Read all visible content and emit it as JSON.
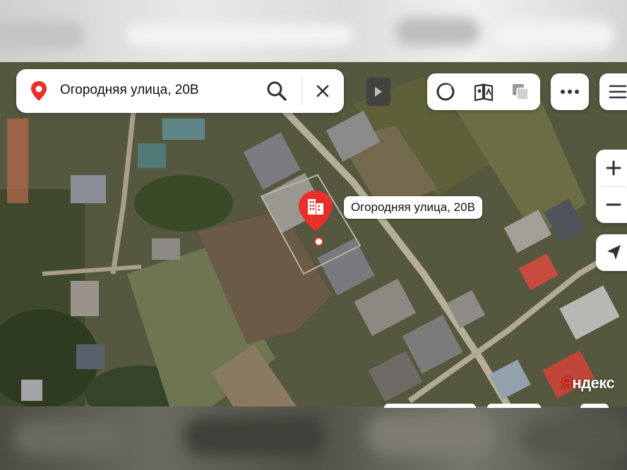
{
  "search": {
    "query": "Огородняя улица, 20В",
    "icons": {
      "pin": "location-pin-icon",
      "search": "search-icon",
      "close": "close-icon"
    }
  },
  "toolbar": {
    "icons": [
      "alice-assistant-icon",
      "panorama-book-icon",
      "layers-icon"
    ],
    "more_icon": "more-dots-icon",
    "menu_icon": "hamburger-menu-icon"
  },
  "zoom": {
    "in_label": "+",
    "out_label": "−"
  },
  "locate_icon": "navigate-arrow-icon",
  "marker": {
    "label": "Огородняя улица, 20В",
    "icon": "building-icon",
    "color": "#e8302b"
  },
  "brand": {
    "first_letter": "Я",
    "rest": "ндекс"
  }
}
